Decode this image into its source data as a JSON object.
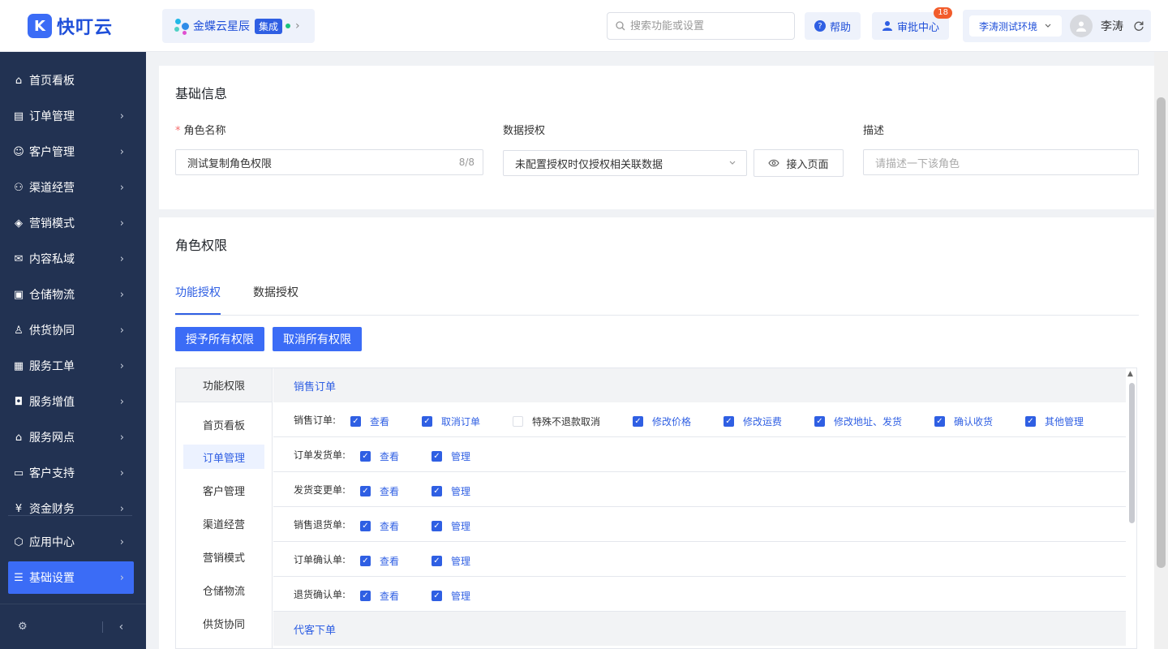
{
  "app": {
    "logo_mark": "K",
    "logo_text": "快叮云"
  },
  "org": {
    "name": "金蝶云星辰",
    "tag": "集成",
    "arrow": "›"
  },
  "header": {
    "search_placeholder": "搜索功能或设置",
    "help_label": "帮助",
    "approval_label": "审批中心",
    "approval_badge": "18",
    "env_label": "李涛测试环境",
    "user_name": "李涛"
  },
  "sidebar": {
    "items": [
      {
        "icon": "home-icon",
        "label": "首页看板"
      },
      {
        "icon": "clipboard-icon",
        "label": "订单管理"
      },
      {
        "icon": "user-icon",
        "label": "客户管理"
      },
      {
        "icon": "channel-icon",
        "label": "渠道经营"
      },
      {
        "icon": "tag-icon",
        "label": "营销模式"
      },
      {
        "icon": "mail-icon",
        "label": "内容私域"
      },
      {
        "icon": "warehouse-icon",
        "label": "仓储物流"
      },
      {
        "icon": "supply-icon",
        "label": "供货协同"
      },
      {
        "icon": "ticket-icon",
        "label": "服务工单"
      },
      {
        "icon": "bag-icon",
        "label": "服务增值"
      },
      {
        "icon": "store-icon",
        "label": "服务网点"
      },
      {
        "icon": "support-icon",
        "label": "客户支持"
      },
      {
        "icon": "yuan-icon",
        "label": "资金财务"
      },
      {
        "icon": "cube-icon",
        "label": "应用中心"
      },
      {
        "icon": "settings-list-icon",
        "label": "基础设置"
      }
    ]
  },
  "basic": {
    "title": "基础信息",
    "role_name_label": "角色名称",
    "role_name_value": "测试复制角色权限",
    "role_name_count": "8/8",
    "data_auth_label": "数据授权",
    "data_auth_value": "未配置授权时仅授权相关联数据",
    "access_page_label": "接入页面",
    "desc_label": "描述",
    "desc_placeholder": "请描述一下该角色"
  },
  "perm": {
    "title": "角色权限",
    "tabs": [
      "功能授权",
      "数据授权"
    ],
    "grant_all": "授予所有权限",
    "revoke_all": "取消所有权限",
    "left_head": "功能权限",
    "left_items": [
      "首页看板",
      "订单管理",
      "客户管理",
      "渠道经营",
      "营销模式",
      "仓储物流",
      "供货协同"
    ],
    "group1": "销售订单",
    "group2": "代客下单",
    "rows": [
      {
        "label": "销售订单:",
        "opts": [
          "查看",
          "取消订单",
          "特殊不退款取消",
          "修改价格",
          "修改运费",
          "修改地址、发货",
          "确认收货",
          "其他管理"
        ]
      },
      {
        "label": "订单发货单:",
        "opts": [
          "查看",
          "管理"
        ]
      },
      {
        "label": "发货变更单:",
        "opts": [
          "查看",
          "管理"
        ]
      },
      {
        "label": "销售退货单:",
        "opts": [
          "查看",
          "管理"
        ]
      },
      {
        "label": "订单确认单:",
        "opts": [
          "查看",
          "管理"
        ]
      },
      {
        "label": "退货确认单:",
        "opts": [
          "查看",
          "管理"
        ]
      }
    ],
    "checked_state": {
      "row0_opt2": false,
      "others": true
    }
  },
  "colors": {
    "primary": "#3b6cf6",
    "sidebar_bg": "#223252",
    "link": "#2f5fe3"
  }
}
